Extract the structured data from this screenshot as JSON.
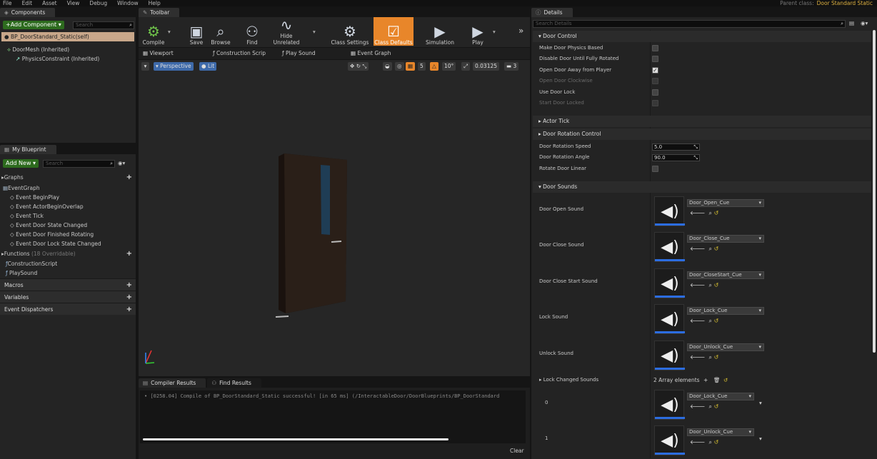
{
  "menu": [
    "File",
    "Edit",
    "Asset",
    "View",
    "Debug",
    "Window",
    "Help"
  ],
  "parent_class": {
    "label": "Parent class:",
    "value": "Door Standard Static"
  },
  "components": {
    "tab": "Components",
    "add_button": "+Add Component",
    "search_placeholder": "Search",
    "self_item": "BP_DoorStandard_Static(self)",
    "items": [
      "DoorMesh (Inherited)",
      "PhysicsConstraint (Inherited)"
    ]
  },
  "my_blueprint": {
    "tab": "My Blueprint",
    "add_button": "Add New",
    "search_placeholder": "Search",
    "graphs_label": "Graphs",
    "event_graph": "EventGraph",
    "events": [
      "Event BeginPlay",
      "Event ActorBeginOverlap",
      "Event Tick",
      "Event Door State Changed",
      "Event Door Finished Rotating",
      "Event Door Lock State Changed"
    ],
    "functions_label": "Functions",
    "functions_note": "(18 Overridable)",
    "functions": [
      "ConstructionScript",
      "PlaySound"
    ],
    "macros": "Macros",
    "variables": "Variables",
    "dispatchers": "Event Dispatchers"
  },
  "toolbar": {
    "tab": "Toolbar",
    "buttons": [
      "Compile",
      "Save",
      "Browse",
      "Find",
      "Hide Unrelated",
      "Class Settings",
      "Class Defaults",
      "Simulation",
      "Play"
    ]
  },
  "editor_tabs": [
    "Viewport",
    "Construction Scrip",
    "Play Sound",
    "Event Graph"
  ],
  "viewport": {
    "perspective": "Perspective",
    "lit": "Lit",
    "grid_snap": "5",
    "rot_snap": "10°",
    "scale_snap": "0.03125",
    "camera_speed": "3"
  },
  "compiler": {
    "tabs": [
      "Compiler Results",
      "Find Results"
    ],
    "message": "[0258.04] Compile of BP_DoorStandard_Static successful! [in 65 ms] (/InteractableDoor/DoorBlueprints/BP_DoorStandard",
    "clear": "Clear"
  },
  "details": {
    "tab": "Details",
    "search_placeholder": "Search Details",
    "door_control": {
      "title": "Door Control",
      "props": [
        {
          "label": "Make Door Physics Based",
          "checked": false,
          "enabled": true
        },
        {
          "label": "Disable Door Until Fully Rotated",
          "checked": false,
          "enabled": true
        },
        {
          "label": "Open Door Away from Player",
          "checked": true,
          "enabled": true
        },
        {
          "label": "Open Door Clockwise",
          "checked": false,
          "enabled": false
        },
        {
          "label": "Use Door Lock",
          "checked": false,
          "enabled": true
        },
        {
          "label": "Start Door Locked",
          "checked": false,
          "enabled": false
        }
      ]
    },
    "actor_tick": "Actor Tick",
    "rotation": {
      "title": "Door Rotation Control",
      "speed_label": "Door Rotation Speed",
      "speed": "5.0",
      "angle_label": "Door Rotation Angle",
      "angle": "90.0",
      "linear_label": "Rotate Door Linear"
    },
    "sounds": {
      "title": "Door Sounds",
      "items": [
        {
          "label": "Door Open Sound",
          "cue": "Door_Open_Cue"
        },
        {
          "label": "Door Close Sound",
          "cue": "Door_Close_Cue"
        },
        {
          "label": "Door Close Start Sound",
          "cue": "Door_CloseStart_Cue"
        },
        {
          "label": "Lock Sound",
          "cue": "Door_Lock_Cue"
        },
        {
          "label": "Unlock Sound",
          "cue": "Door_Unlock_Cue"
        }
      ],
      "lock_changed_label": "Lock Changed Sounds",
      "array_count": "2 Array elements",
      "array": [
        {
          "index": "0",
          "cue": "Door_Lock_Cue"
        },
        {
          "index": "1",
          "cue": "Door_Unlock_Cue"
        }
      ]
    }
  }
}
